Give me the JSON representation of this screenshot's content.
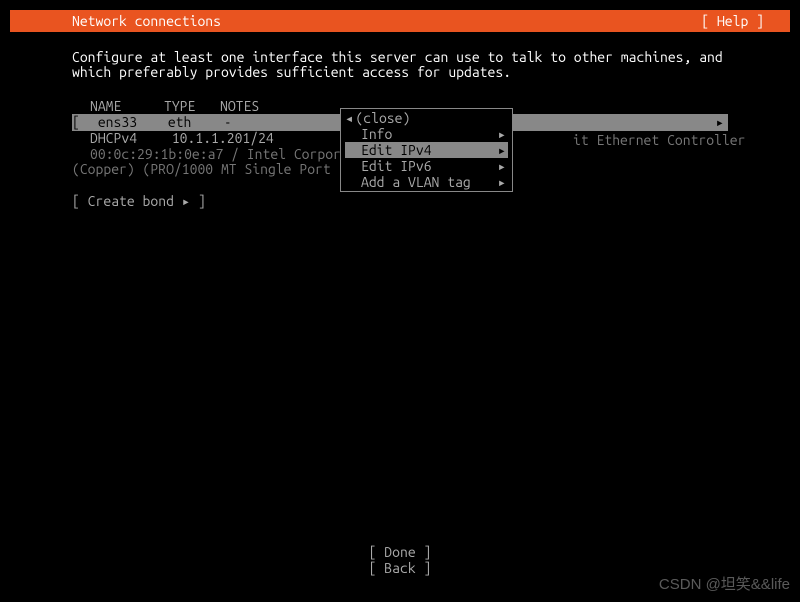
{
  "header": {
    "title": "Network connections",
    "help": "[ Help ]"
  },
  "instructions": "Configure at least one interface this server can use to talk to other machines, and which preferably provides sufficient access for updates.",
  "columns": {
    "name": "NAME",
    "type": "TYPE",
    "notes": "NOTES"
  },
  "interface": {
    "bracket_l": "[",
    "name": "ens33",
    "type": "eth",
    "notes_dash": "-",
    "arrow": "▸",
    "dhcp_label": "DHCPv4",
    "dhcp_addr": "10.1.1.201/24",
    "mac_line": "00:0c:29:1b:0e:a7 / Intel Corpor",
    "eth_suffix": "it Ethernet Controller",
    "copper_line": "(Copper) (PRO/1000 MT Single Port"
  },
  "create_bond": "[ Create bond ▸ ]",
  "popup": {
    "close": {
      "arrow": "◂",
      "label": "(close)"
    },
    "items": [
      {
        "label": "Info",
        "arrow": "▸",
        "selected": false
      },
      {
        "label": "Edit IPv4",
        "arrow": "▸",
        "selected": true
      },
      {
        "label": "Edit IPv6",
        "arrow": "▸",
        "selected": false
      },
      {
        "label": "Add a VLAN tag",
        "arrow": "▸",
        "selected": false
      }
    ]
  },
  "buttons": {
    "done": "[ Done       ]",
    "back": "[ Back       ]"
  },
  "watermark": "CSDN @坦笑&&life"
}
